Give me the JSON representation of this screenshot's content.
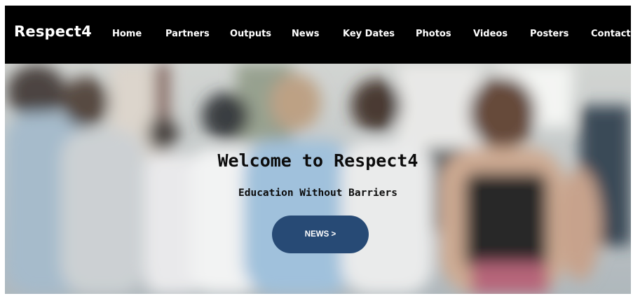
{
  "header": {
    "logo": "Respect4",
    "nav": [
      {
        "label": "Home"
      },
      {
        "label": "Partners"
      },
      {
        "label": "Outputs"
      },
      {
        "label": "News"
      },
      {
        "label": "Key Dates"
      },
      {
        "label": "Photos"
      },
      {
        "label": "Videos"
      },
      {
        "label": "Posters"
      },
      {
        "label": "Contact"
      }
    ]
  },
  "hero": {
    "title": "Welcome to Respect4",
    "subtitle": "Education Without Barriers",
    "button_label": "NEWS >",
    "button_color": "#274a75"
  }
}
